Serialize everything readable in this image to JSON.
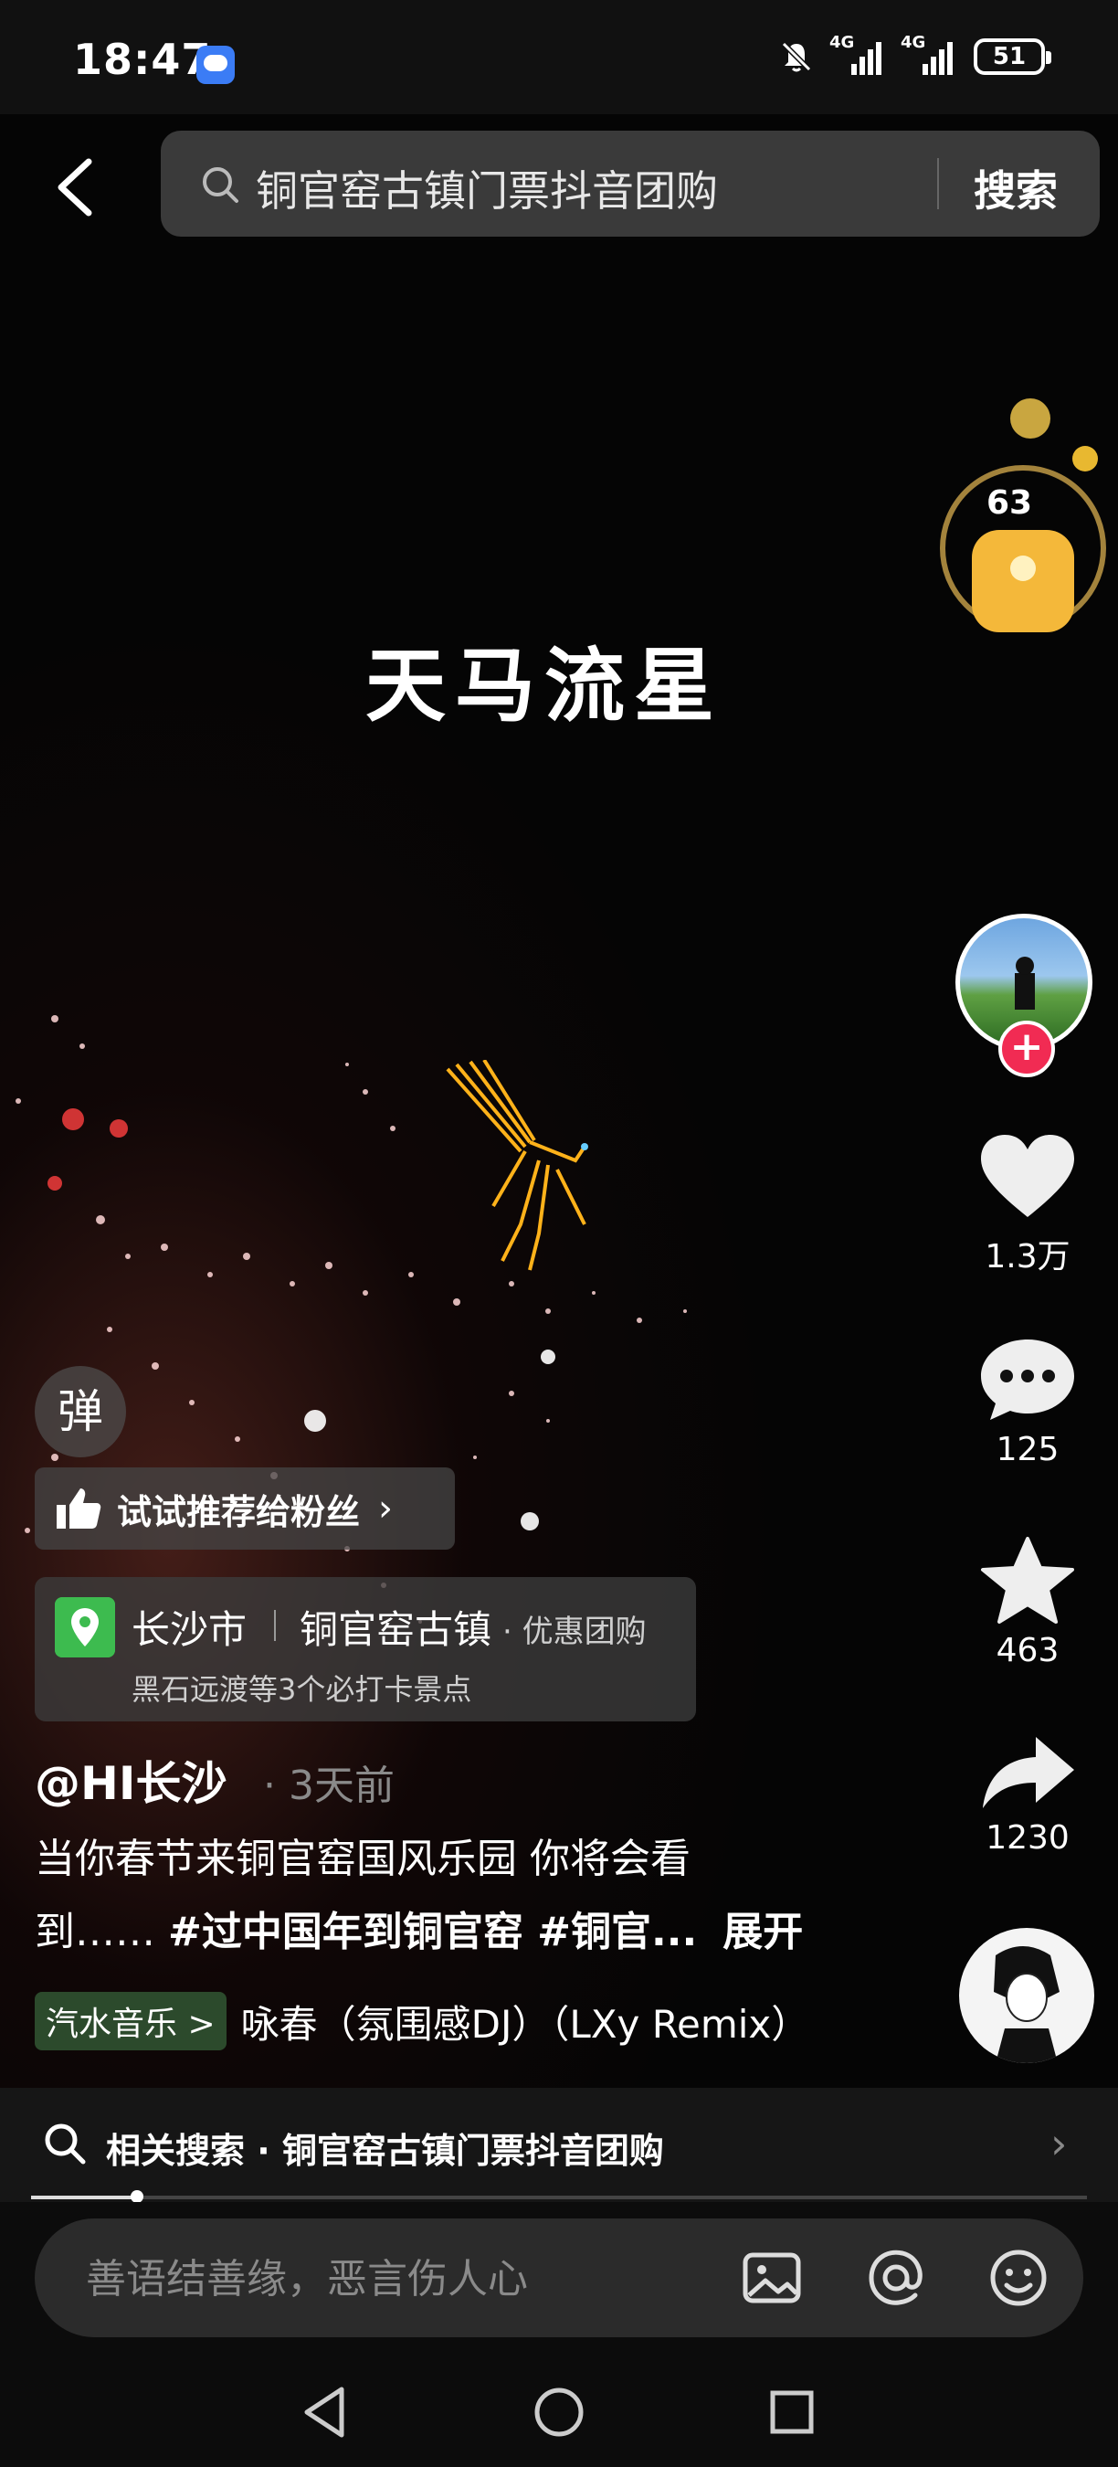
{
  "status": {
    "time": "18:47",
    "network1": "4G",
    "network2": "4G",
    "battery": "51"
  },
  "search": {
    "query": "铜官窑古镇门票抖音团购",
    "button": "搜索"
  },
  "video": {
    "overlay_title": "天马流星",
    "coin_count": "63",
    "progress": 0.1
  },
  "rail": {
    "likes": "1.3万",
    "comments": "125",
    "favorites": "463",
    "shares": "1230"
  },
  "recommend": {
    "label": "试试推荐给粉丝"
  },
  "danmaku": {
    "label": "弹"
  },
  "location": {
    "city": "长沙市",
    "place": "铜官窑古镇",
    "deal": "· 优惠团购",
    "sub": "黑石远渡等3个必打卡景点"
  },
  "post": {
    "author": "@HI长沙",
    "time_ago": "· 3天前",
    "caption_line1": "当你春节来铜官窑国风乐园 你将会看",
    "caption_line2_prefix": "到……",
    "caption_hashtags": "#过中国年到铜官窑 #铜官...",
    "expand": "展开"
  },
  "music": {
    "tag": "汽水音乐 >",
    "title": "咏春（氛围感DJ）（LXy Remix）"
  },
  "related": {
    "label": "相关搜索 · 铜官窑古镇门票抖音团购"
  },
  "comment": {
    "placeholder": "善语结善缘，恶言伤人心"
  },
  "icons": [
    "back-icon",
    "search-icon",
    "heart-icon",
    "comment-icon",
    "star-icon",
    "share-icon",
    "image-icon",
    "at-icon",
    "emoji-icon",
    "location-pin-icon",
    "thumbs-up-icon"
  ]
}
